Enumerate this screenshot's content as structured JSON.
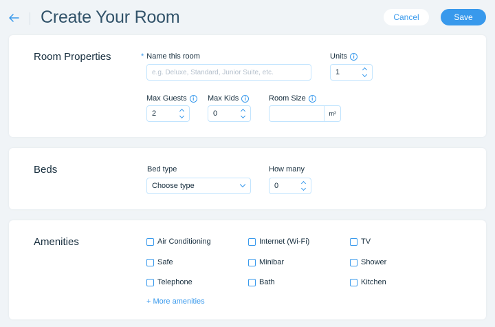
{
  "header": {
    "title": "Create Your Room",
    "cancel_label": "Cancel",
    "save_label": "Save",
    "back_icon": "arrow-left-icon"
  },
  "accent_color": "#3899ec",
  "room_properties": {
    "title": "Room Properties",
    "name_label": "Name this room",
    "name_required_mark": "*",
    "name_value": "",
    "name_placeholder": "e.g. Deluxe, Standard, Junior Suite, etc.",
    "units_label": "Units",
    "units_value": "1",
    "max_guests_label": "Max Guests",
    "max_guests_value": "2",
    "max_kids_label": "Max Kids",
    "max_kids_value": "0",
    "room_size_label": "Room Size",
    "room_size_value": "",
    "room_size_unit": "m²"
  },
  "beds": {
    "title": "Beds",
    "bed_type_label": "Bed type",
    "bed_type_value": "Choose type",
    "how_many_label": "How many",
    "how_many_value": "0"
  },
  "amenities": {
    "title": "Amenities",
    "items": [
      {
        "label": "Air Conditioning",
        "checked": false
      },
      {
        "label": "Internet (Wi-Fi)",
        "checked": false
      },
      {
        "label": "TV",
        "checked": false
      },
      {
        "label": "Safe",
        "checked": false
      },
      {
        "label": "Minibar",
        "checked": false
      },
      {
        "label": "Shower",
        "checked": false
      },
      {
        "label": "Telephone",
        "checked": false
      },
      {
        "label": "Bath",
        "checked": false
      },
      {
        "label": "Kitchen",
        "checked": false
      }
    ],
    "more_link": "+ More amenities"
  },
  "info_icon": "info-icon"
}
